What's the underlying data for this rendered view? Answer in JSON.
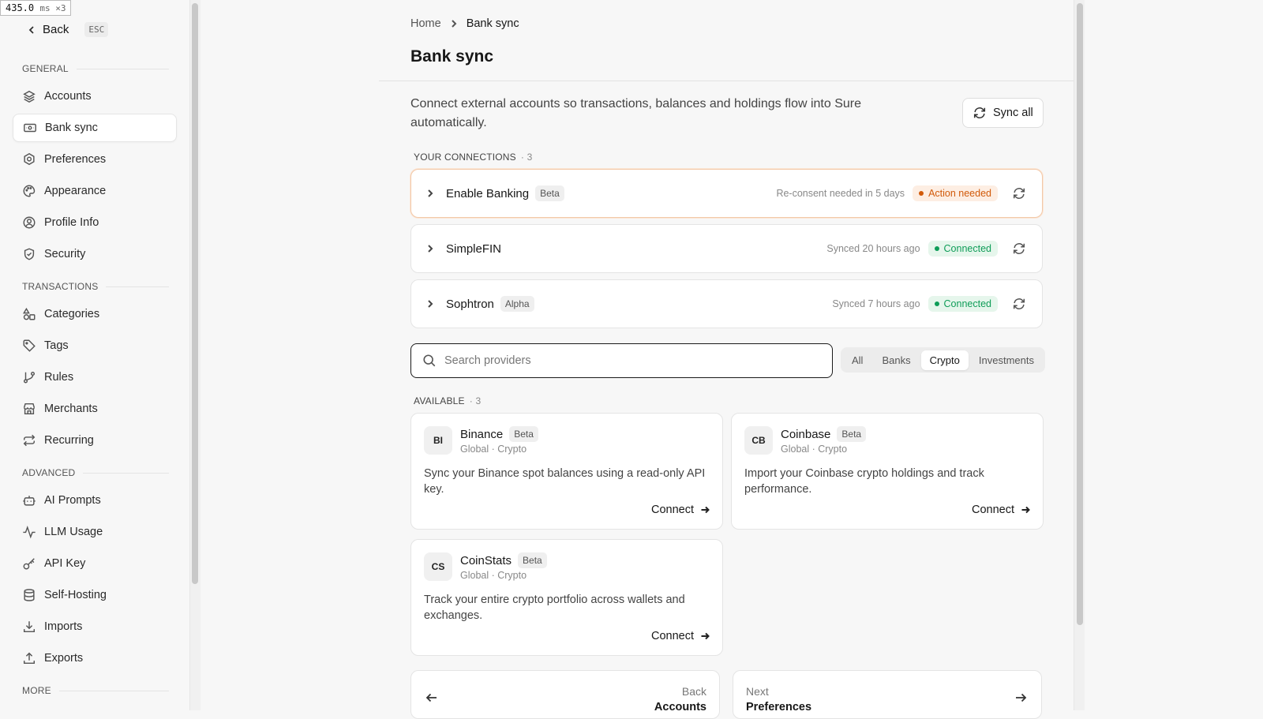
{
  "perf": {
    "value": "435.0",
    "unit": "ms ×3"
  },
  "sidebar": {
    "back_label": "Back",
    "back_kbd": "ESC",
    "sections": [
      {
        "title": "GENERAL",
        "items": [
          "Accounts",
          "Bank sync",
          "Preferences",
          "Appearance",
          "Profile Info",
          "Security"
        ]
      },
      {
        "title": "TRANSACTIONS",
        "items": [
          "Categories",
          "Tags",
          "Rules",
          "Merchants",
          "Recurring"
        ]
      },
      {
        "title": "ADVANCED",
        "items": [
          "AI Prompts",
          "LLM Usage",
          "API Key",
          "Self-Hosting",
          "Imports",
          "Exports"
        ]
      },
      {
        "title": "MORE",
        "items": []
      }
    ],
    "active": "Bank sync"
  },
  "breadcrumb": {
    "home": "Home",
    "current": "Bank sync"
  },
  "page": {
    "title": "Bank sync",
    "description": "Connect external accounts so transactions, balances and holdings flow into Sure automatically.",
    "sync_all": "Sync all"
  },
  "connections": {
    "title": "YOUR CONNECTIONS",
    "count": "· 3",
    "items": [
      {
        "name": "Enable Banking",
        "tag": "Beta",
        "status_text": "Re-consent needed in 5 days",
        "badge": "Action needed",
        "state": "warn"
      },
      {
        "name": "SimpleFIN",
        "tag": "",
        "status_text": "Synced 20 hours ago",
        "badge": "Connected",
        "state": "ok"
      },
      {
        "name": "Sophtron",
        "tag": "Alpha",
        "status_text": "Synced 7 hours ago",
        "badge": "Connected",
        "state": "ok"
      }
    ]
  },
  "search": {
    "placeholder": "Search providers"
  },
  "filters": {
    "items": [
      "All",
      "Banks",
      "Crypto",
      "Investments"
    ],
    "selected": "Crypto"
  },
  "available": {
    "title": "AVAILABLE",
    "count": "· 3",
    "items": [
      {
        "logo": "BI",
        "name": "Binance",
        "tag": "Beta",
        "sub": "Global · Crypto",
        "desc": "Sync your Binance spot balances using a read-only API key.",
        "action": "Connect"
      },
      {
        "logo": "CB",
        "name": "Coinbase",
        "tag": "Beta",
        "sub": "Global · Crypto",
        "desc": "Import your Coinbase crypto holdings and track performance.",
        "action": "Connect"
      },
      {
        "logo": "CS",
        "name": "CoinStats",
        "tag": "Beta",
        "sub": "Global · Crypto",
        "desc": "Track your entire crypto portfolio across wallets and exchanges.",
        "action": "Connect"
      }
    ]
  },
  "pager": {
    "prev_label": "Back",
    "prev_value": "Accounts",
    "next_label": "Next",
    "next_value": "Preferences"
  }
}
